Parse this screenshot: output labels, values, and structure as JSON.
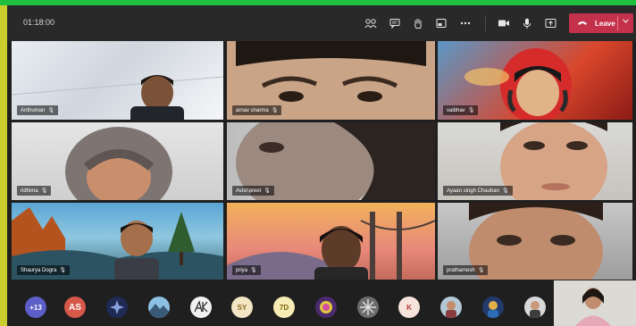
{
  "meeting": {
    "timer": "01:18:00"
  },
  "toolbar": {
    "icons": [
      "participants-icon",
      "chat-icon",
      "raise-hand-icon",
      "rooms-icon",
      "more-icon",
      "camera-icon",
      "mic-icon",
      "share-icon"
    ],
    "leave_label": "Leave"
  },
  "participants": [
    {
      "name": "Anthuman"
    },
    {
      "name": "arnav sharma"
    },
    {
      "name": "vaibhav"
    },
    {
      "name": "ridhima"
    },
    {
      "name": "Avishpreet"
    },
    {
      "name": "Ayaan singh Chauhan"
    },
    {
      "name": "Shaurya Dogra"
    },
    {
      "name": "priya"
    },
    {
      "name": "prathamesh"
    }
  ],
  "strip": {
    "overflow": "+13",
    "initials": [
      "AS",
      "SY",
      "7D",
      "K"
    ]
  },
  "colors": {
    "accent_leave": "#c4314b",
    "overflow_badge": "#5b5fc7",
    "border": "#c9ce2e"
  }
}
